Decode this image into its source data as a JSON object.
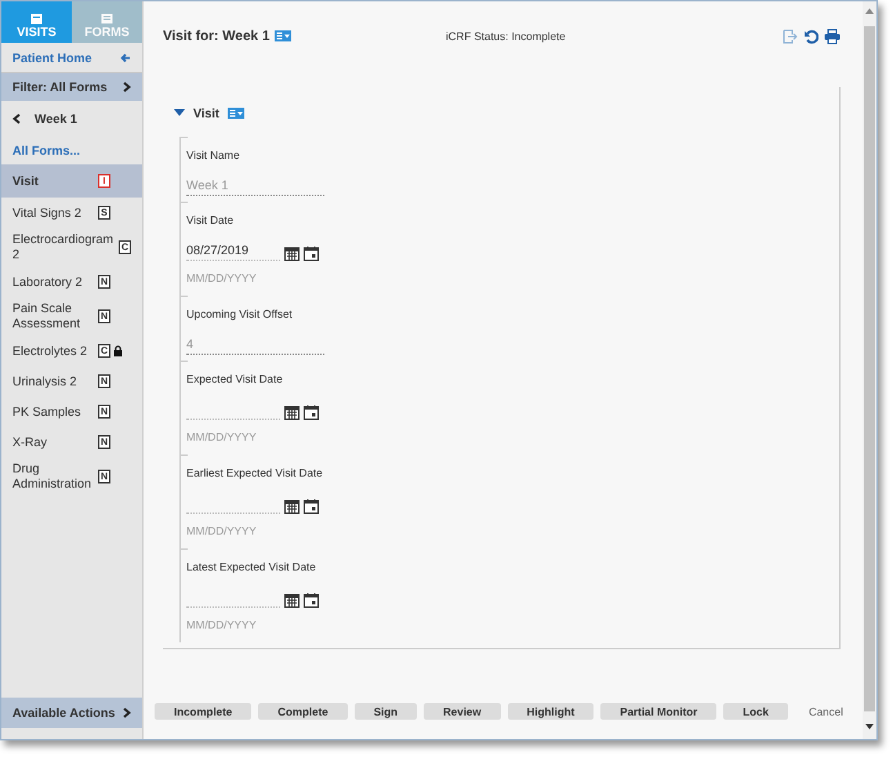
{
  "tabs": [
    {
      "label": "VISITS",
      "selected": true
    },
    {
      "label": "FORMS",
      "selected": false
    }
  ],
  "patient_home": {
    "label": "Patient Home"
  },
  "filter": {
    "label": "Filter: All Forms"
  },
  "week": {
    "label": "Week 1"
  },
  "all_forms": {
    "label": "All Forms..."
  },
  "forms": [
    {
      "label": "Visit",
      "badge": "I",
      "color": "#d9302c",
      "locked": false,
      "selected": true
    },
    {
      "label": "Vital Signs 2",
      "badge": "S",
      "color": "#333333",
      "locked": false,
      "selected": false
    },
    {
      "label": "Electrocardiogram 2",
      "badge": "C",
      "color": "#333333",
      "locked": false,
      "selected": false
    },
    {
      "label": "Laboratory 2",
      "badge": "N",
      "color": "#333333",
      "locked": false,
      "selected": false
    },
    {
      "label": "Pain Scale Assessment",
      "badge": "N",
      "color": "#333333",
      "locked": false,
      "selected": false
    },
    {
      "label": "Electrolytes 2",
      "badge": "C",
      "color": "#333333",
      "locked": true,
      "selected": false
    },
    {
      "label": "Urinalysis 2",
      "badge": "N",
      "color": "#333333",
      "locked": false,
      "selected": false
    },
    {
      "label": "PK Samples",
      "badge": "N",
      "color": "#333333",
      "locked": false,
      "selected": false
    },
    {
      "label": "X-Ray",
      "badge": "N",
      "color": "#333333",
      "locked": false,
      "selected": false
    },
    {
      "label": "Drug Administration",
      "badge": "N",
      "color": "#333333",
      "locked": false,
      "selected": false
    }
  ],
  "available_actions": {
    "label": "Available Actions"
  },
  "header": {
    "title": "Visit for: Week 1",
    "status": "iCRF Status: Incomplete"
  },
  "section": {
    "title": "Visit",
    "expanded": true
  },
  "fields": [
    {
      "kind": "text",
      "label": "Visit Name",
      "value": "Week 1",
      "disabled": true
    },
    {
      "kind": "date",
      "label": "Visit Date",
      "value": "08/27/2019",
      "hint": "MM/DD/YYYY"
    },
    {
      "kind": "text",
      "label": "Upcoming Visit Offset",
      "value": "4",
      "disabled": true
    },
    {
      "kind": "date",
      "label": "Expected Visit Date",
      "hint": "MM/DD/YYYY"
    },
    {
      "kind": "date",
      "label": "Earliest Expected Visit Date",
      "hint": "MM/DD/YYYY"
    },
    {
      "kind": "date",
      "label": "Latest Expected Visit Date",
      "hint": "MM/DD/YYYY"
    }
  ],
  "buttons": [
    {
      "label": "Incomplete",
      "kind": "button"
    },
    {
      "label": "Complete",
      "kind": "button"
    },
    {
      "label": "Sign",
      "kind": "button"
    },
    {
      "label": "Review",
      "kind": "button"
    },
    {
      "label": "Highlight",
      "kind": "button"
    },
    {
      "label": "Partial Monitor",
      "kind": "button"
    },
    {
      "label": "Lock",
      "kind": "button"
    },
    {
      "label": "Cancel",
      "kind": "link"
    }
  ]
}
